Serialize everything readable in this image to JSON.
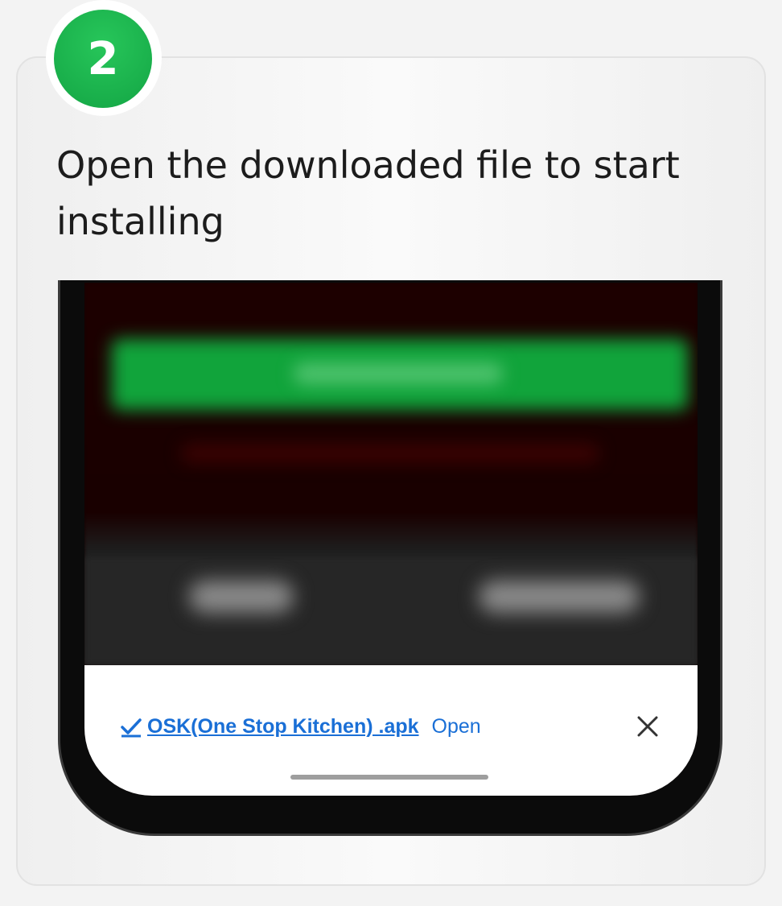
{
  "step": {
    "number": "2",
    "title": "Open the downloaded file to start installing"
  },
  "download_bar": {
    "file_name": "OSK(One Stop Kitchen) .apk",
    "open_label": "Open",
    "check_icon": "check-icon",
    "close_icon": "close-icon"
  },
  "colors": {
    "badge_green": "#13a544",
    "link_blue": "#1a6fd6"
  }
}
